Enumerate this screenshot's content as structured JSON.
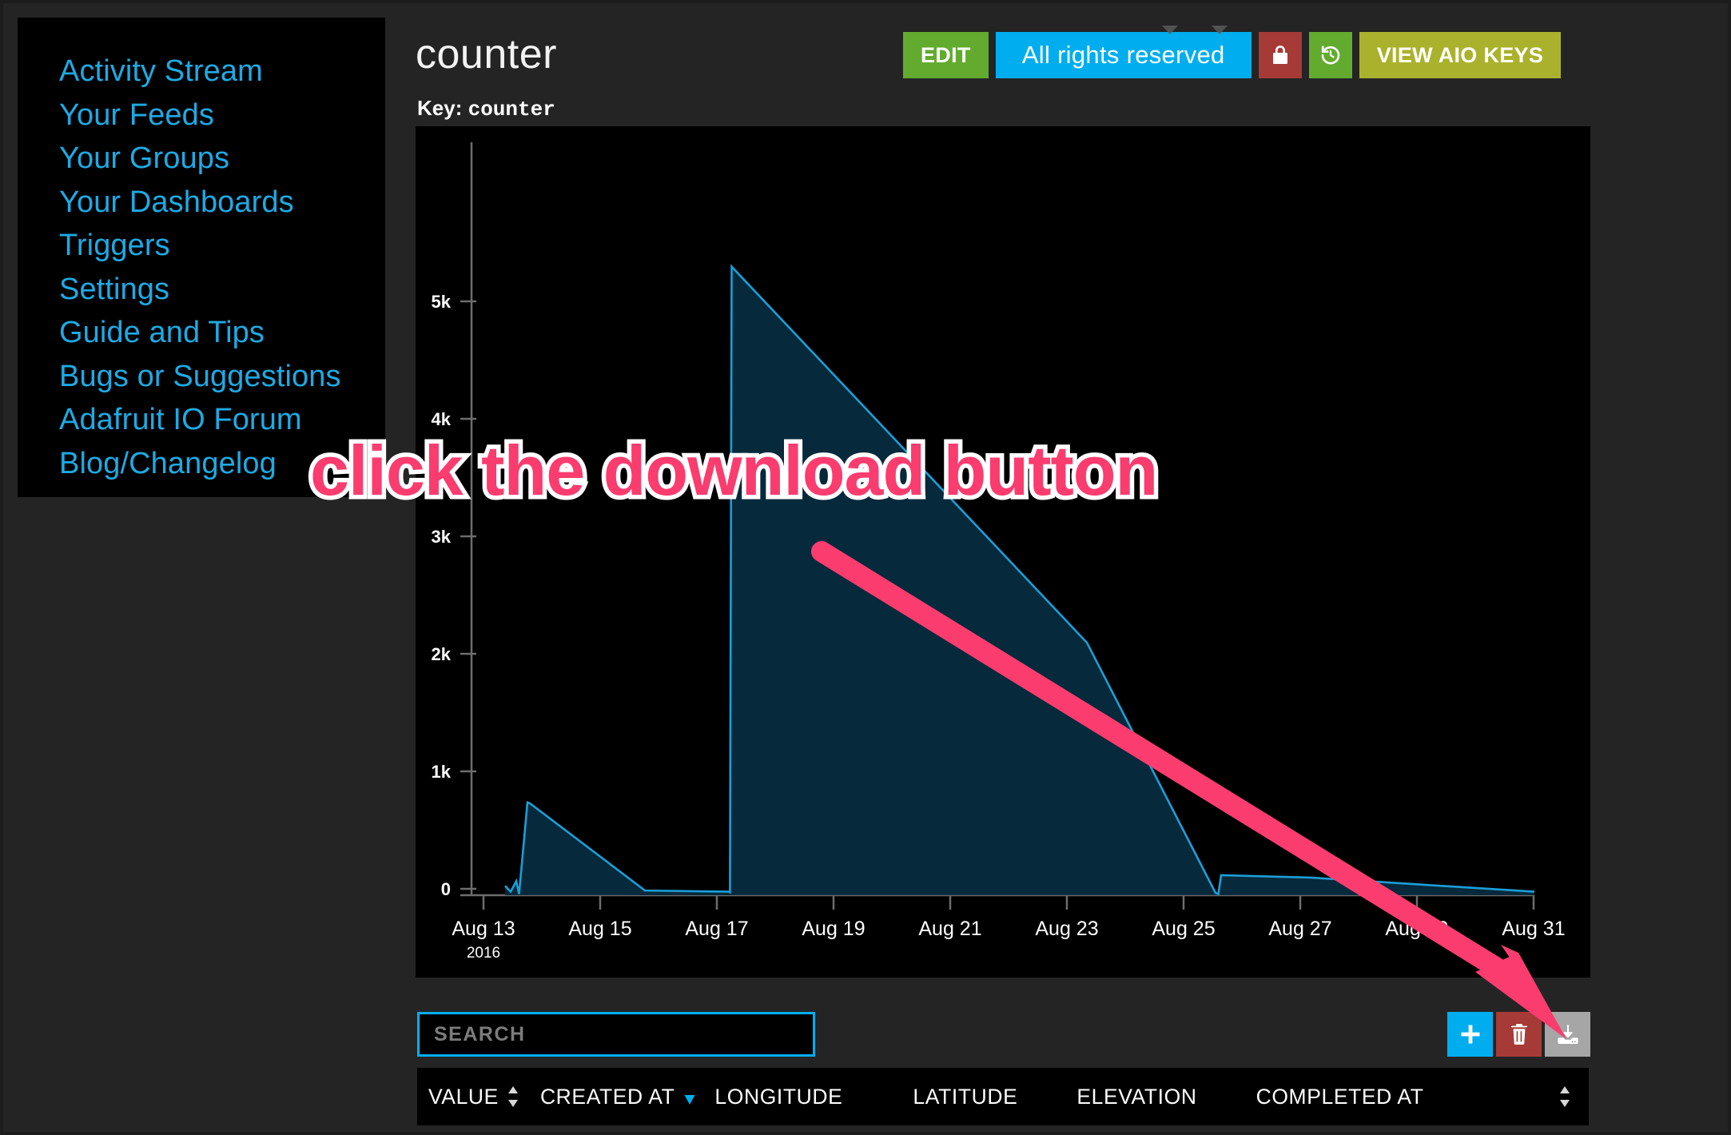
{
  "app": {
    "background_color": "#242424",
    "accent_blue": "#00aeef",
    "accent_green": "#63ab2e",
    "accent_red": "#a63a36",
    "accent_olive": "#aab22d",
    "annotation_color": "#fa3c6e"
  },
  "sidebar": {
    "items": [
      {
        "label": "Activity Stream"
      },
      {
        "label": "Your Feeds"
      },
      {
        "label": "Your Groups"
      },
      {
        "label": "Your Dashboards"
      },
      {
        "label": "Triggers"
      },
      {
        "label": "Settings"
      },
      {
        "label": "Guide and Tips"
      },
      {
        "label": "Bugs or Suggestions"
      },
      {
        "label": "Adafruit IO Forum"
      },
      {
        "label": "Blog/Changelog"
      }
    ]
  },
  "header": {
    "title": "counter",
    "key_label": "Key:",
    "key_value": "counter"
  },
  "toolbar": {
    "edit_label": "EDIT",
    "privacy_label": "All rights reserved",
    "lock_icon": "lock-icon",
    "history_icon": "history-icon",
    "keys_label": "VIEW AIO KEYS"
  },
  "annotation": {
    "text": "click the download button"
  },
  "bottom": {
    "search_placeholder": "SEARCH",
    "search_value": "",
    "add_icon": "plus-icon",
    "delete_icon": "trash-icon",
    "download_icon": "download-icon"
  },
  "table": {
    "columns": [
      {
        "label": "VALUE",
        "sort": "both"
      },
      {
        "label": "CREATED AT",
        "sort": "desc"
      },
      {
        "label": "LONGITUDE",
        "sort": "none"
      },
      {
        "label": "LATITUDE",
        "sort": "none"
      },
      {
        "label": "ELEVATION",
        "sort": "none"
      },
      {
        "label": "COMPLETED AT",
        "sort": "none"
      }
    ],
    "trailing_sort": "both"
  },
  "chart_data": {
    "type": "area",
    "title": "counter",
    "xlabel": "",
    "ylabel": "",
    "series_color": "#1b9fd8",
    "fill_color": "#06293b",
    "grid": false,
    "legend": false,
    "ylim": [
      0,
      5800
    ],
    "ytick_labels": [
      "0",
      "1k",
      "2k",
      "3k",
      "4k",
      "5k"
    ],
    "ytick_values": [
      0,
      1000,
      2000,
      3000,
      4000,
      5000
    ],
    "xtick_labels": [
      "Aug 13",
      "Aug 15",
      "Aug 17",
      "Aug 19",
      "Aug 21",
      "Aug 23",
      "Aug 25",
      "Aug 27",
      "Aug 29",
      "Aug 31"
    ],
    "x_year_label": "2016",
    "xlim": [
      "Aug 12",
      "Aug 31"
    ],
    "x": [
      "Aug 12.6",
      "Aug 12.7",
      "Aug 12.8",
      "Aug 12.85",
      "Aug 13.0",
      "Aug 13.05",
      "Aug 15.1",
      "Aug 16.6",
      "Aug 16.62",
      "Aug 16.65",
      "Aug 23.0",
      "Aug 25.3",
      "Aug 25.35",
      "Aug 25.4",
      "Aug 27.0",
      "Aug 31.0"
    ],
    "values": [
      80,
      30,
      120,
      10,
      790,
      780,
      40,
      30,
      25,
      5350,
      2150,
      20,
      10,
      170,
      150,
      30
    ],
    "annotations": [
      {
        "text": "click the download button",
        "color": "#fa3c6e"
      }
    ]
  }
}
